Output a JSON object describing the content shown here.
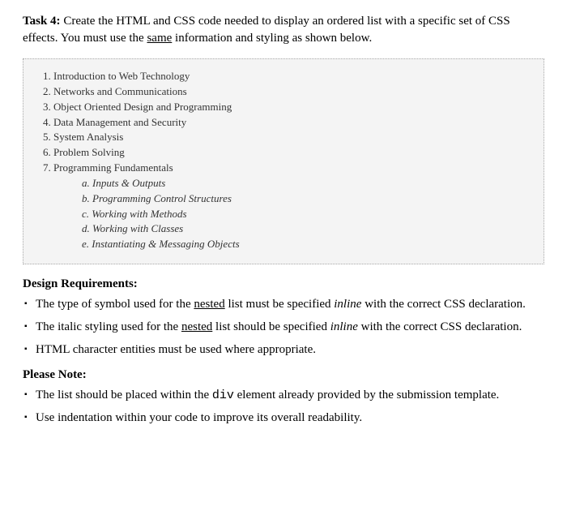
{
  "task": {
    "label_bold": "Task 4:",
    "desc_part1": " Create the HTML and CSS code needed to display an ordered list with a specific set of CSS effects. You must use the ",
    "desc_underline": "same",
    "desc_part2": " information and styling as shown below."
  },
  "example_list": {
    "items": [
      "Introduction to Web Technology",
      "Networks and Communications",
      "Object Oriented Design and Programming",
      "Data Management and Security",
      "System Analysis",
      "Problem Solving",
      "Programming Fundamentals"
    ],
    "nested_items": [
      "Inputs & Outputs",
      "Programming Control Structures",
      "Working with Methods",
      "Working with Classes",
      "Instantiating & Messaging Objects"
    ]
  },
  "design_requirements": {
    "heading": "Design Requirements:",
    "items": {
      "r1": {
        "pre": "The type of symbol used for the ",
        "u": "nested",
        "mid": " list must be specified ",
        "it": "inline",
        "post": " with the correct CSS declaration."
      },
      "r2": {
        "pre": "The italic styling used for the ",
        "u": "nested",
        "mid": " list should be specified ",
        "it": "inline",
        "post": " with the correct CSS declaration."
      },
      "r3": {
        "text": "HTML character entities must be used where appropriate."
      }
    }
  },
  "please_note": {
    "heading": "Please Note:",
    "items": {
      "n1": {
        "pre": "The list should be placed within the ",
        "code": "div",
        "post": " element already provided by the submission template."
      },
      "n2": {
        "text": "Use indentation within your code to improve its overall readability."
      }
    }
  }
}
